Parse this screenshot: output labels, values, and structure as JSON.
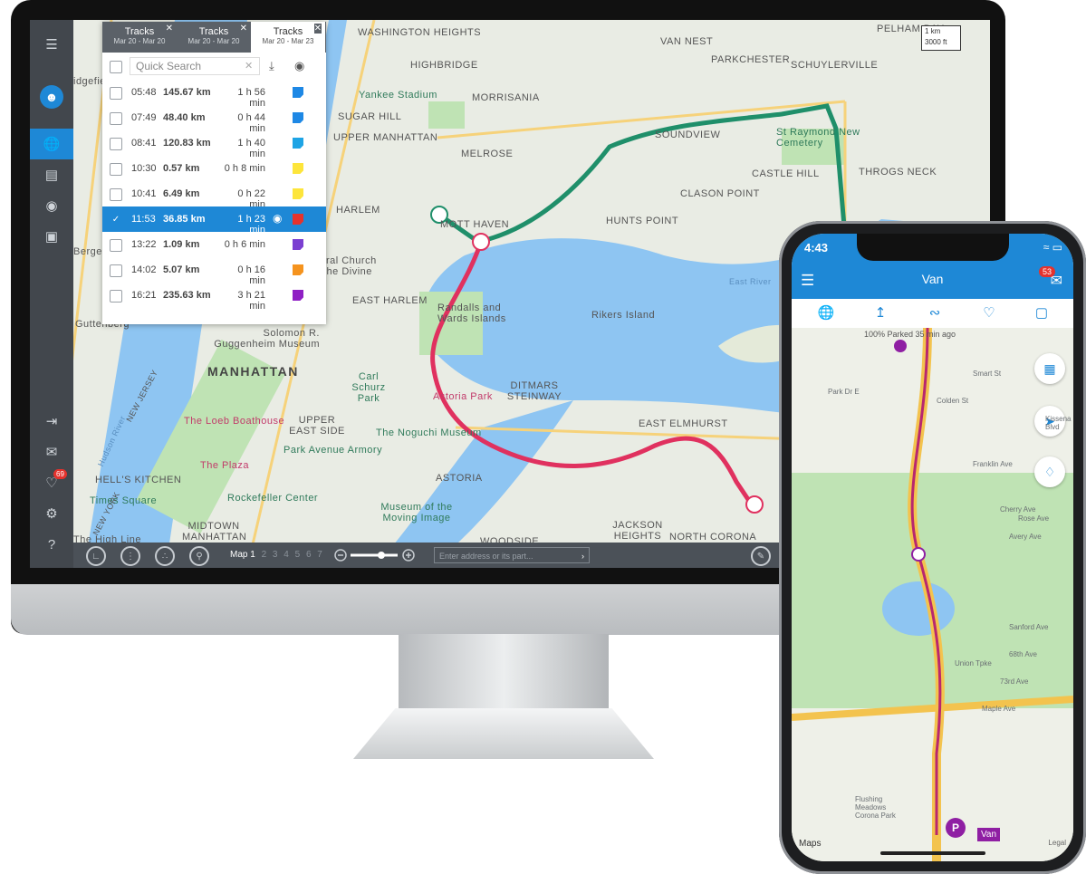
{
  "desktop": {
    "sidebar": {
      "badge": "69"
    },
    "tracks_panel": {
      "tabs": [
        {
          "title": "Tracks",
          "dates": "Mar 20 - Mar 20"
        },
        {
          "title": "Tracks",
          "dates": "Mar 20 - Mar 20"
        },
        {
          "title": "Tracks",
          "dates": "Mar 20 - Mar 23"
        }
      ],
      "search_placeholder": "Quick Search",
      "rows": [
        {
          "time": "05:48",
          "distance": "145.67 km",
          "duration": "1 h 56 min",
          "color": "#1e88e5",
          "selected": false
        },
        {
          "time": "07:49",
          "distance": "48.40 km",
          "duration": "0 h 44 min",
          "color": "#1e88e5",
          "selected": false
        },
        {
          "time": "08:41",
          "distance": "120.83 km",
          "duration": "1 h 40 min",
          "color": "#1ea4e5",
          "selected": false
        },
        {
          "time": "10:30",
          "distance": "0.57 km",
          "duration": "0 h 8 min",
          "color": "#fde53b",
          "selected": false
        },
        {
          "time": "10:41",
          "distance": "6.49 km",
          "duration": "0 h 22 min",
          "color": "#fde53b",
          "selected": false
        },
        {
          "time": "11:53",
          "distance": "36.85 km",
          "duration": "1 h 23 min",
          "color": "#e5322d",
          "selected": true
        },
        {
          "time": "13:22",
          "distance": "1.09 km",
          "duration": "0 h 6 min",
          "color": "#7b3fd1",
          "selected": false
        },
        {
          "time": "14:02",
          "distance": "5.07 km",
          "duration": "0 h 16 min",
          "color": "#f5931e",
          "selected": false
        },
        {
          "time": "16:21",
          "distance": "235.63 km",
          "duration": "3 h 21 min",
          "color": "#8f1fc4",
          "selected": false
        }
      ]
    },
    "bottom_bar": {
      "map_label": "Map 1",
      "map_numbers": [
        "2",
        "3",
        "4",
        "5",
        "6",
        "7"
      ],
      "address_placeholder": "Enter address or its part..."
    },
    "scale": {
      "km": "1 km",
      "ft": "3000 ft"
    },
    "map_labels": {
      "washington_heights": "WASHINGTON HEIGHTS",
      "highbridge": "HIGHBRIDGE",
      "van_nest": "VAN NEST",
      "parkchester": "PARKCHESTER",
      "schuylerville": "SCHUYLERVILLE",
      "pelham_bay": "PELHAM BAY",
      "yankee_stadium": "Yankee Stadium",
      "morrisania": "MORRISANIA",
      "sugar_hill": "SUGAR HILL",
      "upper_manhattan": "UPPER MANHATTAN",
      "melrose": "MELROSE",
      "soundview": "SOUNDVIEW",
      "st_raymond": "St Raymond New Cemetery",
      "castle_hill": "CASTLE HILL",
      "throgs_neck": "THROGS NECK",
      "clason_point": "CLASON POINT",
      "harlem": "HARLEM",
      "mott_haven": "MOTT HAVEN",
      "hunts_point": "HUNTS POINT",
      "riverside_church": "iral Church the Divine",
      "east_harlem": "EAST HARLEM",
      "randalls": "Randalls and Wards Islands",
      "rikers": "Rikers Island",
      "guggenheim": "Solomon R. Guggenheim Museum",
      "manhattan": "MANHATTAN",
      "carl_schurz": "Carl Schurz Park",
      "astoria_park": "Astoria Park",
      "ditmars": "DITMARS STEINWAY",
      "east_elmhurst": "EAST ELMHURST",
      "loeb": "The Loeb Boathouse",
      "upper_east_side": "UPPER EAST SIDE",
      "noguchi": "The Noguchi Museum",
      "park_ave_armory": "Park Avenue Armory",
      "plaza": "The Plaza",
      "astoria": "ASTORIA",
      "hells_kitchen": "HELL'S KITCHEN",
      "times_square": "Times Square",
      "rockefeller": "Rockefeller Center",
      "midtown": "MIDTOWN MANHATTAN",
      "museum_moving_image": "Museum of the Moving Image",
      "jackson_heights": "JACKSON HEIGHTS",
      "north_corona": "NORTH CORONA",
      "woodside": "WOODSIDE",
      "bergen": "Bergen",
      "guttenberg": "Guttenberg",
      "ridgefield": "idgefie",
      "high_line": "The High Line",
      "new_jersey": "NEW JERSEY",
      "new_york": "NEW YORK",
      "hudson_river": "Hudson River",
      "east_river": "East River"
    }
  },
  "phone": {
    "time": "4:43",
    "title": "Van",
    "badge": "53",
    "info": "100%  Parked   35 min ago",
    "van_label": "Van",
    "parking": "P",
    "maps": "Maps",
    "legal": "Legal",
    "park_label": "Flushing Meadows Corona Park",
    "streets": [
      "Maple Ave",
      "Rose Ave",
      "Cherry Ave",
      "Avery Ave",
      "Sanford Ave",
      "Franklin Ave",
      "Colden St",
      "Kissena Blvd",
      "Smart St",
      "Union Tpke",
      "68th Ave",
      "73rd Ave",
      "Park Dr E"
    ]
  }
}
